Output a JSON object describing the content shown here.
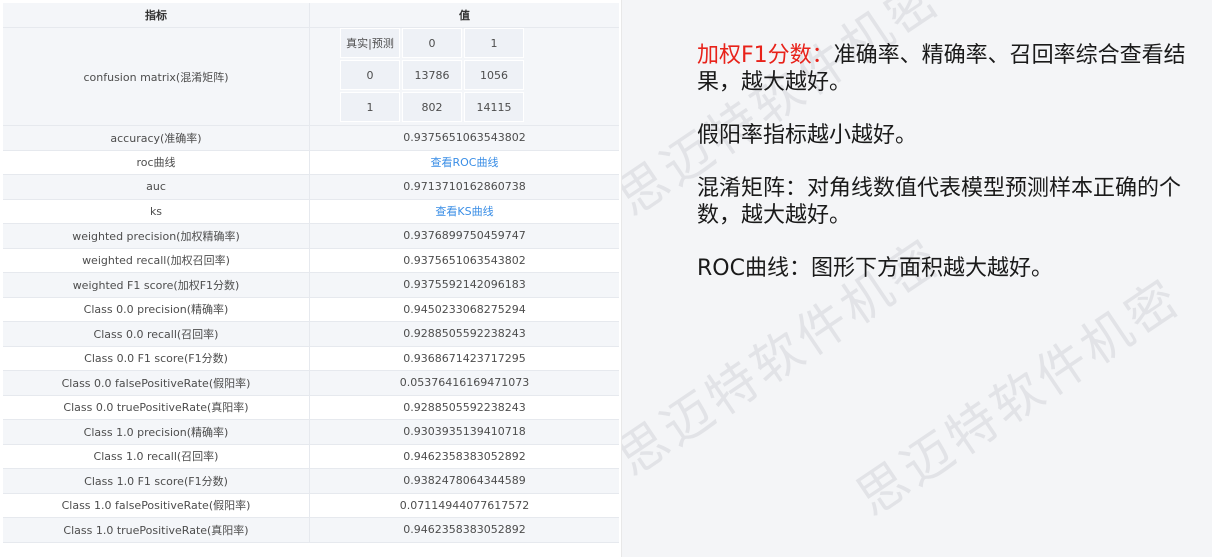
{
  "table": {
    "header": {
      "metric": "指标",
      "value": "值"
    },
    "confusion_matrix": {
      "label": "confusion matrix(混淆矩阵)",
      "corner": "真实|预测",
      "col_headers": [
        "0",
        "1"
      ],
      "rows": [
        {
          "label": "0",
          "values": [
            "13786",
            "1056"
          ]
        },
        {
          "label": "1",
          "values": [
            "802",
            "14115"
          ]
        }
      ]
    },
    "rows": [
      {
        "metric": "accuracy(准确率)",
        "value": "0.9375651063543802"
      },
      {
        "metric": "roc曲线",
        "link": "查看ROC曲线"
      },
      {
        "metric": "auc",
        "value": "0.9713710162860738"
      },
      {
        "metric": "ks",
        "link": "查看KS曲线"
      },
      {
        "metric": "weighted precision(加权精确率)",
        "value": "0.9376899750459747"
      },
      {
        "metric": "weighted recall(加权召回率)",
        "value": "0.9375651063543802"
      },
      {
        "metric": "weighted F1 score(加权F1分数)",
        "value": "0.9375592142096183"
      },
      {
        "metric": "Class 0.0 precision(精确率)",
        "value": "0.9450233068275294"
      },
      {
        "metric": "Class 0.0 recall(召回率)",
        "value": "0.9288505592238243"
      },
      {
        "metric": "Class 0.0 F1 score(F1分数)",
        "value": "0.9368671423717295"
      },
      {
        "metric": "Class 0.0 falsePositiveRate(假阳率)",
        "value": "0.05376416169471073"
      },
      {
        "metric": "Class 0.0 truePositiveRate(真阳率)",
        "value": "0.9288505592238243"
      },
      {
        "metric": "Class 1.0 precision(精确率)",
        "value": "0.9303935139410718"
      },
      {
        "metric": "Class 1.0 recall(召回率)",
        "value": "0.9462358383052892"
      },
      {
        "metric": "Class 1.0 F1 score(F1分数)",
        "value": "0.9382478064344589"
      },
      {
        "metric": "Class 1.0 falsePositiveRate(假阳率)",
        "value": "0.07114944077617572"
      },
      {
        "metric": "Class 1.0 truePositiveRate(真阳率)",
        "value": "0.9462358383052892"
      }
    ]
  },
  "notes": [
    {
      "highlight": "加权F1分数：",
      "text": "准确率、精确率、召回率综合查看结果，越大越好。"
    },
    {
      "highlight": "",
      "text": "假阳率指标越小越好。"
    },
    {
      "highlight": "",
      "text": "混淆矩阵：对角线数值代表模型预测样本正确的个数，越大越好。"
    },
    {
      "highlight": "",
      "text": "ROC曲线：图形下方面积越大越好。"
    }
  ],
  "watermark": "思迈特软件机密",
  "colors": {
    "highlight": "#e8221a",
    "link": "#3a8ee6",
    "row_shade": "#f4f6f9",
    "slide_bg": "#f4f5f7"
  }
}
